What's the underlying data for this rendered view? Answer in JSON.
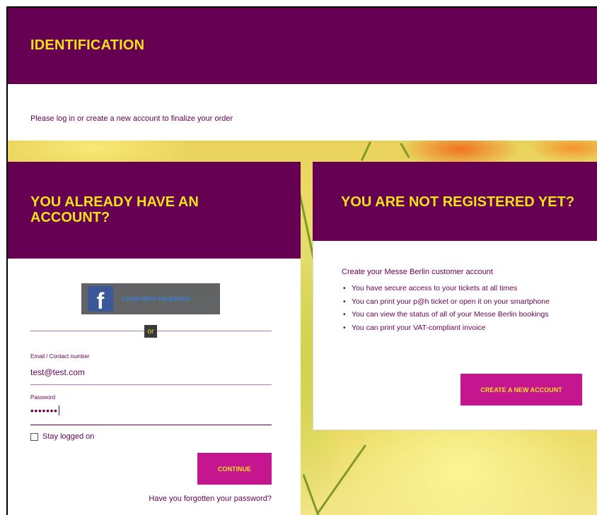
{
  "header": {
    "title": "IDENTIFICATION"
  },
  "intro": {
    "text": "Please log in or create a new account to finalize your order"
  },
  "login": {
    "heading": "YOU ALREADY HAVE AN ACCOUNT?",
    "facebook_label": "LOGIN WITH FACEBOOK",
    "or_label": "or",
    "email_label": "Email / Contact number",
    "email_value": "test@test.com",
    "password_label": "Password",
    "password_value": "•••••••",
    "stay_logged_label": "Stay logged on",
    "continue_label": "CONTINUE",
    "forgot_label": "Have you forgotten your password?"
  },
  "register": {
    "heading": "YOU ARE NOT REGISTERED YET?",
    "lead": "Create your Messe Berlin customer account",
    "benefits": [
      "You have secure access to your tickets at all times",
      "You can print your p@h ticket or open it on your smartphone",
      "You can view the status of all of your Messe Berlin bookings",
      "You can print your VAT-compliant invoice"
    ],
    "create_label": "CREATE A NEW ACCOUNT"
  },
  "colors": {
    "brand_purple": "#650052",
    "accent_yellow": "#f0e11c",
    "button_magenta": "#c5158f",
    "facebook_blue": "#3b5998"
  },
  "icons": {
    "facebook": "facebook-icon"
  }
}
